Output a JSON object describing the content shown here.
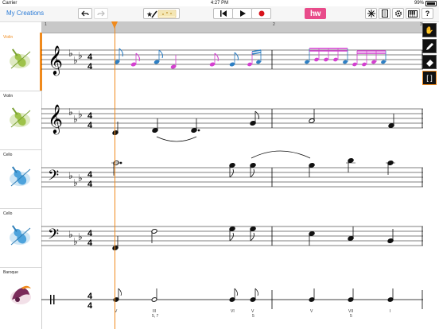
{
  "status": {
    "carrier": "Carrier",
    "time": "4:27 PM",
    "battery": "99%"
  },
  "nav": {
    "back_label": "My Creations",
    "hw_label": "hw"
  },
  "ruler": {
    "marks": [
      "1",
      "2",
      "3"
    ]
  },
  "tracks": [
    {
      "name": "Violin",
      "selected": true
    },
    {
      "name": "Violin",
      "selected": false
    },
    {
      "name": "Cello",
      "selected": false
    },
    {
      "name": "Cello",
      "selected": false
    },
    {
      "name": "Baroque",
      "selected": false
    }
  ],
  "score": {
    "time_signature_top": "4",
    "time_signature_bottom": "4",
    "roman_numerals": [
      {
        "label": "V",
        "sub": ""
      },
      {
        "label": "III",
        "sub": "5, 7"
      },
      {
        "label": "VI",
        "sub": ""
      },
      {
        "label": "V",
        "sub": "5"
      },
      {
        "label": "V",
        "sub": ""
      },
      {
        "label": "VII",
        "sub": "5"
      },
      {
        "label": "I",
        "sub": ""
      }
    ]
  },
  "colors": {
    "accent": "#f08a1c",
    "note_blue": "#2d7fc4",
    "note_magenta": "#d43fd0",
    "hw": "#e84b8a"
  }
}
